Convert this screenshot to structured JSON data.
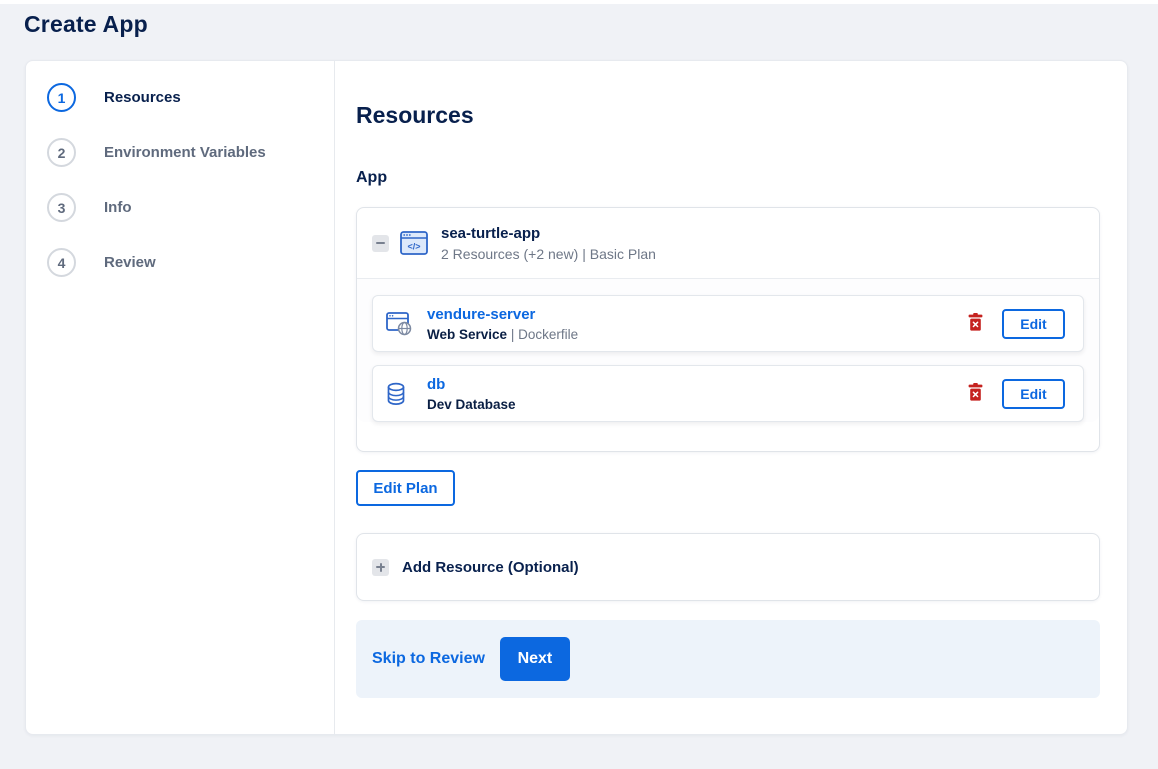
{
  "header": {
    "title": "Create App"
  },
  "stepper": {
    "steps": [
      {
        "number": "1",
        "label": "Resources"
      },
      {
        "number": "2",
        "label": "Environment Variables"
      },
      {
        "number": "3",
        "label": "Info"
      },
      {
        "number": "4",
        "label": "Review"
      }
    ],
    "active_step": "1"
  },
  "content": {
    "heading": "Resources",
    "section_label": "App",
    "app_group": {
      "name": "sea-turtle-app",
      "summary": "2 Resources (+2 new) | Basic Plan",
      "resources": [
        {
          "name": "vendure-server",
          "type": "Web Service",
          "separator": "|",
          "detail": "Dockerfile",
          "action_label": "Edit"
        },
        {
          "name": "db",
          "type": "Dev Database",
          "separator": "",
          "detail": "",
          "action_label": "Edit"
        }
      ]
    },
    "edit_plan_label": "Edit Plan",
    "add_resource": {
      "label": "Add Resource (Optional)"
    },
    "footer": {
      "skip_label": "Skip to Review",
      "next_label": "Next"
    }
  },
  "colors": {
    "accent_blue": "#0c68e0",
    "navy_text": "#08204d",
    "muted_text": "#6e7787",
    "danger_red": "#c5221f",
    "footer_bg": "#edf3fa",
    "page_bg": "#f0f2f6"
  }
}
